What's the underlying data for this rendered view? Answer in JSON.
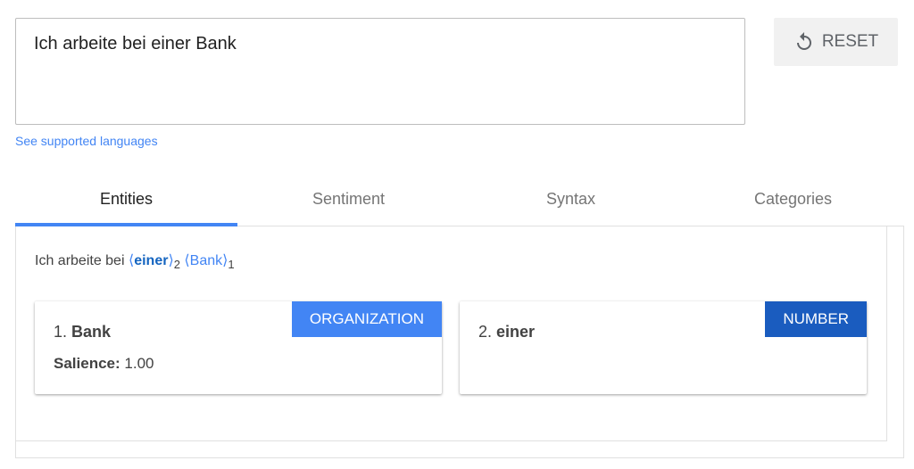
{
  "input": {
    "text": "Ich arbeite bei einer Bank"
  },
  "reset_button": {
    "label": "RESET",
    "icon": "reset-icon"
  },
  "languages_link": "See supported languages",
  "tabs": [
    {
      "label": "Entities",
      "active": true
    },
    {
      "label": "Sentiment",
      "active": false
    },
    {
      "label": "Syntax",
      "active": false
    },
    {
      "label": "Categories",
      "active": false
    }
  ],
  "annotated_text": {
    "prefix": "Ich arbeite bei ",
    "entity_a": {
      "text": "einer",
      "index": "2"
    },
    "entity_b": {
      "text": "Bank",
      "index": "1"
    }
  },
  "entities": [
    {
      "number": "1.",
      "name": "Bank",
      "type": "ORGANIZATION",
      "type_color": "#4285f4",
      "salience_label": "Salience:",
      "salience": "1.00"
    },
    {
      "number": "2.",
      "name": "einer",
      "type": "NUMBER",
      "type_color": "#1a5cbf"
    }
  ],
  "colors": {
    "accent": "#4285f4",
    "number_badge": "#1a5cbf"
  }
}
